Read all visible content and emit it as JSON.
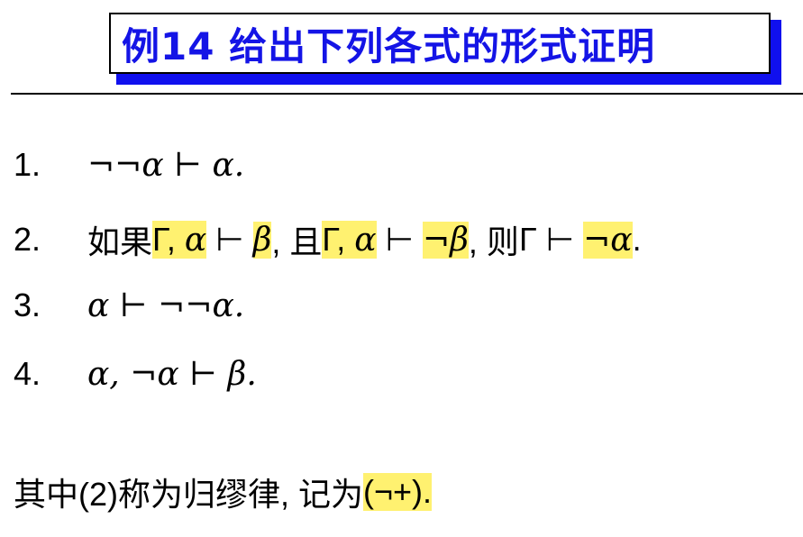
{
  "title": "例14 给出下列各式的形式证明",
  "items": [
    {
      "num": "1.",
      "text": "¬¬α ⊢ α."
    },
    {
      "num": "2.",
      "p1": "如果",
      "g1": "Γ,",
      "a1": "α",
      "t1": "⊢",
      "b1": "β",
      "p2": ", 且",
      "g2": "Γ,",
      "a2": "α",
      "t2": "⊢",
      "n2": "¬",
      "b2": "β",
      "p3": ", 则",
      "g3": "Γ",
      "t3": "⊢",
      "n3": "¬",
      "a3": "α",
      "end": "."
    },
    {
      "num": "3.",
      "text": "α ⊢ ¬¬α."
    },
    {
      "num": "4.",
      "text": "α, ¬α ⊢ β."
    }
  ],
  "note": {
    "text": "其中(2)称为归缪律, 记为",
    "rule": "(¬+)."
  }
}
